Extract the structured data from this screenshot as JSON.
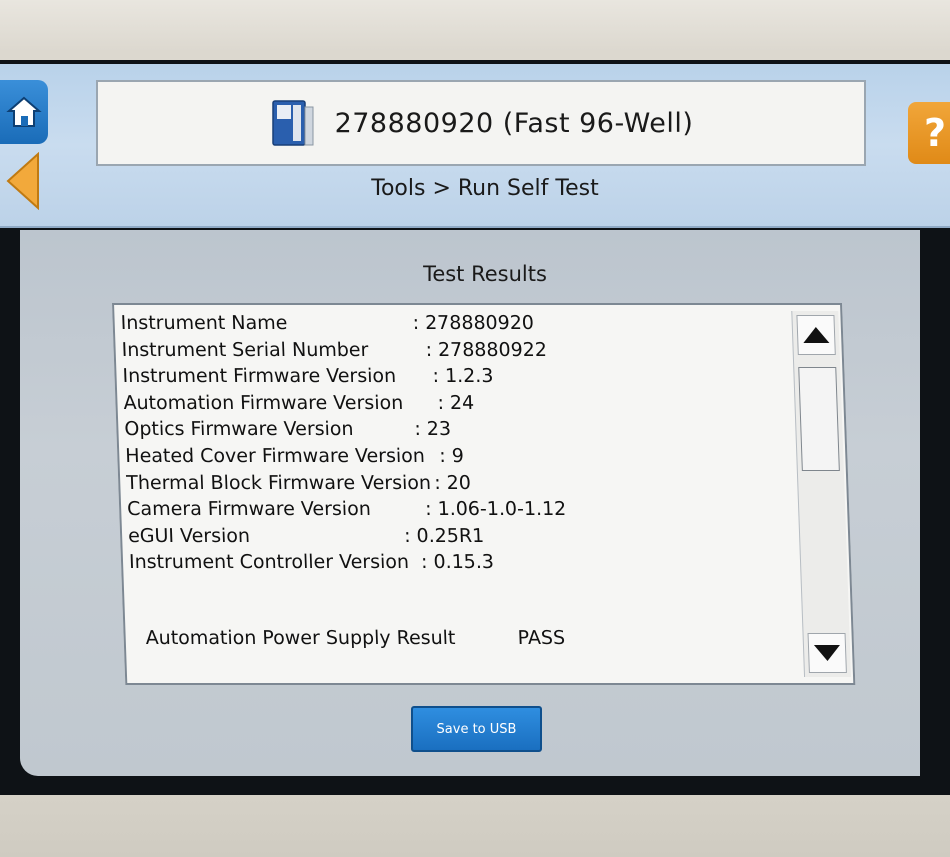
{
  "header": {
    "instrument_title": "278880920 (Fast 96-Well)",
    "breadcrumb": "Tools > Run Self Test",
    "help_label": "?"
  },
  "results": {
    "title": "Test Results",
    "rows": [
      {
        "label": "Instrument Name",
        "value": ": 278880920"
      },
      {
        "label": "Instrument Serial Number",
        "value": ": 278880922"
      },
      {
        "label": "Instrument Firmware Version",
        "value": ": 1.2.3"
      },
      {
        "label": "Automation Firmware Version",
        "value": ": 24"
      },
      {
        "label": "Optics Firmware Version",
        "value": ": 23"
      },
      {
        "label": "Heated Cover Firmware Version",
        "value": ": 9"
      },
      {
        "label": "Thermal Block Firmware Version",
        "value": ": 20"
      },
      {
        "label": "Camera Firmware Version",
        "value": ": 1.06-1.0-1.12"
      },
      {
        "label": "eGUI Version",
        "value": ": 0.25R1"
      },
      {
        "label": "Instrument Controller Version",
        "value": ": 0.15.3"
      }
    ],
    "power_supply": {
      "label": "Automation Power Supply Result",
      "value": "PASS"
    }
  },
  "actions": {
    "save_label": "Save to USB"
  },
  "colors": {
    "header_bg": "#c9dcef",
    "accent_blue": "#1a6fc0",
    "help_orange": "#e08a17"
  },
  "icons": {
    "home": "home-icon",
    "back": "back-arrow-icon",
    "instrument": "instrument-icon",
    "scroll_up": "triangle-up-icon",
    "scroll_down": "triangle-down-icon"
  }
}
